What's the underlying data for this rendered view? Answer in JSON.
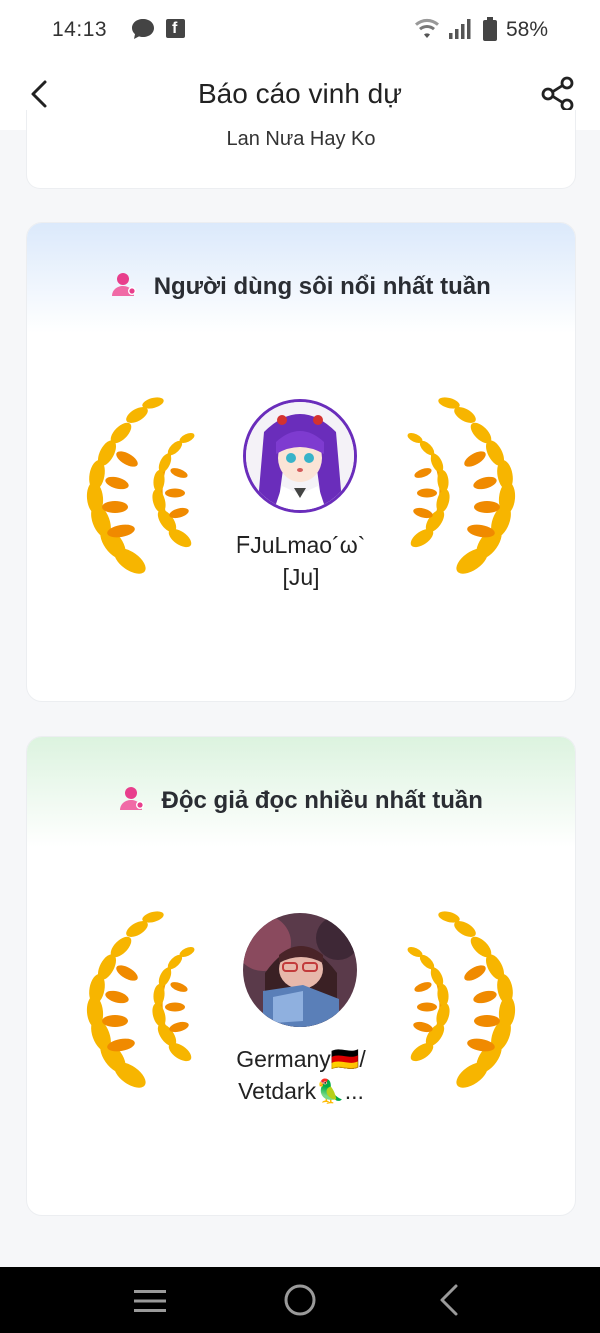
{
  "status_bar": {
    "time": "14:13",
    "battery_percent": "58%",
    "icons": [
      "message-icon",
      "facebook-icon",
      "wifi-icon",
      "signal-icon",
      "battery-icon"
    ]
  },
  "header": {
    "title": "Báo cáo vinh dự",
    "back_icon": "back-arrow-icon",
    "share_icon": "share-icon"
  },
  "previous_card": {
    "text": "Lan Nưa Hay Ko"
  },
  "sections": [
    {
      "heading": "Người dùng sôi nổi nhất tuần",
      "icon": "user-icon",
      "accent": "#dbe9fb",
      "user_name_line1": "ᖴJuLmao´ω`",
      "user_name_line2": "[Ju]"
    },
    {
      "heading": "Độc giả đọc nhiều nhất tuần",
      "icon": "user-icon",
      "accent": "#dcf3df",
      "user_name_line1": "Germany🇩🇪/",
      "user_name_line2": "Vetdark🦜..."
    }
  ],
  "nav_bar": {
    "icons": [
      "menu-icon",
      "home-circle-icon",
      "nav-back-icon"
    ]
  },
  "colors": {
    "laurel_gold": "#f7b500",
    "laurel_orange": "#f08a00",
    "user_icon_pink": "#e83e8c"
  }
}
